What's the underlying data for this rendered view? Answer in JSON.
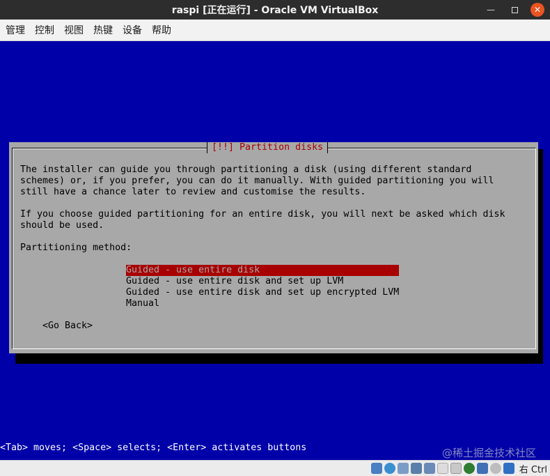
{
  "window": {
    "title": "raspi [正在运行] - Oracle VM VirtualBox",
    "minimize_glyph": "—",
    "close_glyph": "✕"
  },
  "menubar": {
    "items": [
      "管理",
      "控制",
      "视图",
      "热键",
      "设备",
      "帮助"
    ]
  },
  "dialog": {
    "title": "[!!] Partition disks",
    "paragraphs": [
      "The installer can guide you through partitioning a disk (using different standard",
      "schemes) or, if you prefer, you can do it manually. With guided partitioning you will",
      "still have a chance later to review and customise the results.",
      "",
      "If you choose guided partitioning for an entire disk, you will next be asked which disk",
      "should be used."
    ],
    "prompt": "Partitioning method:",
    "options": [
      "Guided - use entire disk",
      "Guided - use entire disk and set up LVM",
      "Guided - use entire disk and set up encrypted LVM",
      "Manual"
    ],
    "selected_index": 0,
    "go_back": "<Go Back>"
  },
  "hint_line": "<Tab> moves; <Space> selects; <Enter> activates buttons",
  "watermark": "@稀土掘金技术社区",
  "statusbar": {
    "host_key": "右 Ctrl",
    "icons": [
      "hard-disk-icon",
      "optical-drive-icon",
      "audio-icon",
      "network-icon",
      "usb-icon",
      "shared-folder-icon",
      "display-icon",
      "video-capture-icon",
      "virtualization-icon",
      "mouse-integration-icon",
      "arrow-down-icon"
    ]
  },
  "colors": {
    "vm_background": "#0000a8",
    "dialog_background": "#a8a8a8",
    "accent_red": "#a80000"
  }
}
